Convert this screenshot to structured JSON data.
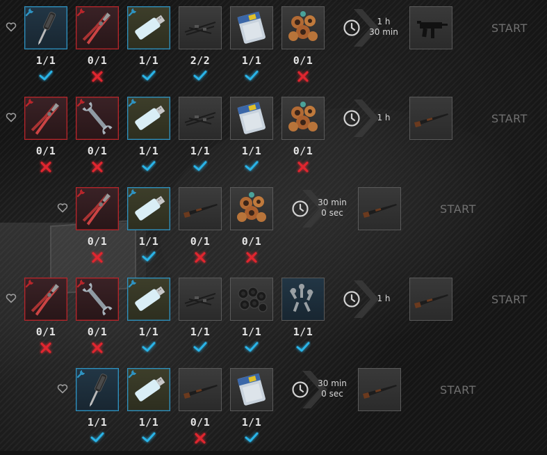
{
  "rows": [
    {
      "id": "row1",
      "items": [
        {
          "icon": "screwdriver-icon",
          "tool": true,
          "state": "ok",
          "have": "1",
          "need": "1"
        },
        {
          "icon": "pliers-icon",
          "tool": true,
          "state": "missing",
          "have": "0",
          "need": "1"
        },
        {
          "icon": "flash-drive-icon",
          "tool": true,
          "state": "ok",
          "have": "1",
          "need": "1"
        },
        {
          "icon": "rifle-parts-icon",
          "tool": false,
          "state": "ok",
          "have": "2",
          "need": "2"
        },
        {
          "icon": "silicone-bag-icon",
          "tool": false,
          "state": "ok",
          "have": "1",
          "need": "1"
        },
        {
          "icon": "copper-pipes-icon",
          "tool": false,
          "state": "missing",
          "have": "0",
          "need": "1"
        }
      ],
      "time_line1": "1 h",
      "time_line2": "30 min",
      "result_icon": "smg-icon",
      "start_label": "START"
    },
    {
      "id": "row2",
      "items": [
        {
          "icon": "pliers-icon",
          "tool": true,
          "state": "missing",
          "have": "0",
          "need": "1"
        },
        {
          "icon": "wrench-icon",
          "tool": true,
          "state": "missing",
          "have": "0",
          "need": "1"
        },
        {
          "icon": "flash-drive-icon",
          "tool": true,
          "state": "ok",
          "have": "1",
          "need": "1"
        },
        {
          "icon": "rifle-parts-icon",
          "tool": false,
          "state": "ok",
          "have": "1",
          "need": "1"
        },
        {
          "icon": "silicone-bag-icon",
          "tool": false,
          "state": "ok",
          "have": "1",
          "need": "1"
        },
        {
          "icon": "copper-pipes-icon",
          "tool": false,
          "state": "missing",
          "have": "0",
          "need": "1"
        }
      ],
      "time_line1": "1 h",
      "time_line2": "",
      "result_icon": "shotgun-icon",
      "start_label": "START"
    },
    {
      "id": "row3",
      "items": [
        {
          "icon": "pliers-icon",
          "tool": true,
          "state": "missing",
          "have": "0",
          "need": "1"
        },
        {
          "icon": "flash-drive-icon",
          "tool": true,
          "state": "ok",
          "have": "1",
          "need": "1"
        },
        {
          "icon": "shotgun-icon",
          "tool": false,
          "state": "missing",
          "have": "0",
          "need": "1"
        },
        {
          "icon": "copper-pipes-icon",
          "tool": false,
          "state": "missing",
          "have": "0",
          "need": "1"
        }
      ],
      "time_line1": "30 min",
      "time_line2": "0 sec",
      "result_icon": "shotgun-icon",
      "start_label": "START"
    },
    {
      "id": "row4",
      "items": [
        {
          "icon": "pliers-icon",
          "tool": true,
          "state": "missing",
          "have": "0",
          "need": "1"
        },
        {
          "icon": "wrench-icon",
          "tool": true,
          "state": "missing",
          "have": "0",
          "need": "1"
        },
        {
          "icon": "flash-drive-icon",
          "tool": true,
          "state": "ok",
          "have": "1",
          "need": "1"
        },
        {
          "icon": "rifle-parts-icon",
          "tool": false,
          "state": "ok",
          "have": "1",
          "need": "1"
        },
        {
          "icon": "rubber-rings-icon",
          "tool": false,
          "state": "ok",
          "have": "1",
          "need": "1"
        },
        {
          "icon": "bolts-icon",
          "tool": false,
          "state": "ok",
          "have": "1",
          "need": "1"
        }
      ],
      "time_line1": "1 h",
      "time_line2": "",
      "result_icon": "shotgun-icon",
      "start_label": "START"
    },
    {
      "id": "row5",
      "items": [
        {
          "icon": "screwdriver-icon",
          "tool": true,
          "state": "ok",
          "have": "1",
          "need": "1"
        },
        {
          "icon": "flash-drive-icon",
          "tool": true,
          "state": "ok",
          "have": "1",
          "need": "1"
        },
        {
          "icon": "shotgun-icon",
          "tool": false,
          "state": "missing",
          "have": "0",
          "need": "1"
        },
        {
          "icon": "silicone-bag-icon",
          "tool": false,
          "state": "ok",
          "have": "1",
          "need": "1"
        }
      ],
      "time_line1": "30 min",
      "time_line2": "0 sec",
      "result_icon": "shotgun-icon",
      "start_label": "START"
    }
  ],
  "colors": {
    "ok": "#2ab4e8",
    "missing": "#e0262f",
    "tool_blue": "#2e93c2",
    "tool_red": "#b8262b"
  }
}
